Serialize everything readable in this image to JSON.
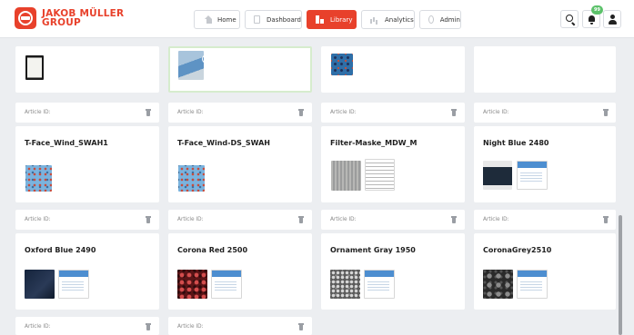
{
  "brand": {
    "name_line1": "JAKOB MÜLLER",
    "name_line2": "GROUP",
    "color": "#e8412b"
  },
  "nav": {
    "items": [
      {
        "label": "Home",
        "icon": "home-icon",
        "active": false
      },
      {
        "label": "Dashboard",
        "icon": "dashboard-icon",
        "active": false
      },
      {
        "label": "Library",
        "icon": "library-icon",
        "active": true
      },
      {
        "label": "Analytics",
        "icon": "analytics-icon",
        "active": false
      },
      {
        "label": "Admin",
        "icon": "admin-icon",
        "active": false
      }
    ]
  },
  "toolbar": {
    "search_icon": "search-icon",
    "notifications_icon": "bell-icon",
    "notification_badge": "99",
    "user_icon": "user-icon"
  },
  "library": {
    "article_id_label": "Article ID:",
    "cards": [
      {
        "title": "T-Face_Wind_SWAH1"
      },
      {
        "title": "T-Face_Wind-DS_SWAH"
      },
      {
        "title": "Filter-Maske_MDW_M"
      },
      {
        "title": "Night Blue 2480"
      },
      {
        "title": "Oxford Blue 2490"
      },
      {
        "title": "Corona Red 2500"
      },
      {
        "title": "Ornament Gray 1950"
      },
      {
        "title": "CoronaGrey2510"
      }
    ]
  }
}
